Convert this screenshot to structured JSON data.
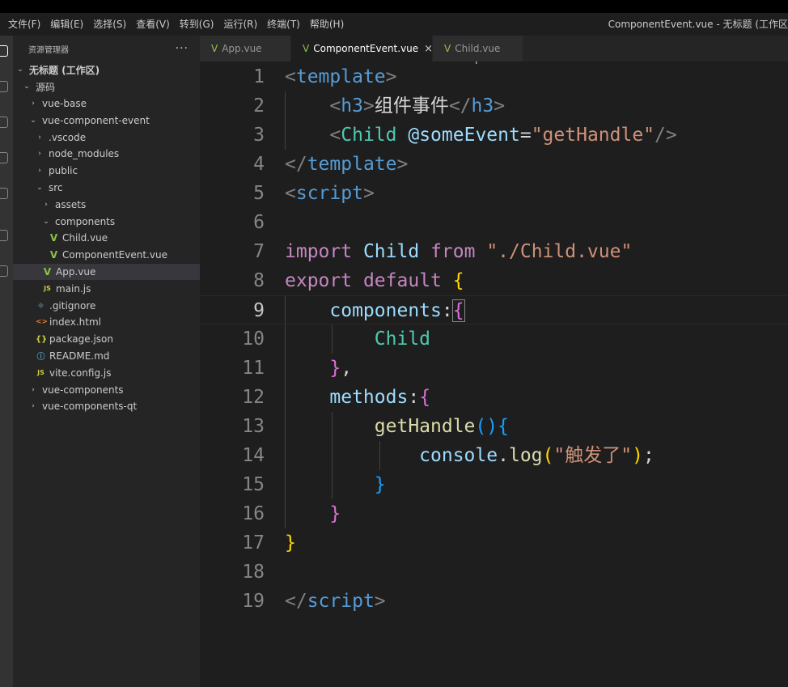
{
  "menu": [
    "文件(F)",
    "编辑(E)",
    "选择(S)",
    "查看(V)",
    "转到(G)",
    "运行(R)",
    "终端(T)",
    "帮助(H)"
  ],
  "window_title": "ComponentEvent.vue - 无标题 (工作区",
  "sidebar": {
    "title": "资源管理器",
    "more": "···",
    "items": [
      {
        "label": "无标题 (工作区)",
        "indent": 0,
        "chev": "v",
        "icon": ""
      },
      {
        "label": "源码",
        "indent": 1,
        "chev": "v",
        "icon": ""
      },
      {
        "label": "vue-base",
        "indent": 2,
        "chev": ">",
        "icon": ""
      },
      {
        "label": "vue-component-event",
        "indent": 2,
        "chev": "v",
        "icon": ""
      },
      {
        "label": ".vscode",
        "indent": 3,
        "chev": ">",
        "icon": ""
      },
      {
        "label": "node_modules",
        "indent": 3,
        "chev": ">",
        "icon": ""
      },
      {
        "label": "public",
        "indent": 3,
        "chev": ">",
        "icon": ""
      },
      {
        "label": "src",
        "indent": 3,
        "chev": "v",
        "icon": ""
      },
      {
        "label": "assets",
        "indent": 4,
        "chev": ">",
        "icon": ""
      },
      {
        "label": "components",
        "indent": 4,
        "chev": "v",
        "icon": ""
      },
      {
        "label": "Child.vue",
        "indent": 5,
        "chev": "",
        "icon": "vue"
      },
      {
        "label": "ComponentEvent.vue",
        "indent": 5,
        "chev": "",
        "icon": "vue"
      },
      {
        "label": "App.vue",
        "indent": 4,
        "chev": "",
        "icon": "vue"
      },
      {
        "label": "main.js",
        "indent": 4,
        "chev": "",
        "icon": "js"
      },
      {
        "label": ".gitignore",
        "indent": 3,
        "chev": "",
        "icon": "git"
      },
      {
        "label": "index.html",
        "indent": 3,
        "chev": "",
        "icon": "html"
      },
      {
        "label": "package.json",
        "indent": 3,
        "chev": "",
        "icon": "json"
      },
      {
        "label": "README.md",
        "indent": 3,
        "chev": "",
        "icon": "info"
      },
      {
        "label": "vite.config.js",
        "indent": 3,
        "chev": "",
        "icon": "js"
      },
      {
        "label": "vue-components",
        "indent": 2,
        "chev": ">",
        "icon": ""
      },
      {
        "label": "vue-components-qt",
        "indent": 2,
        "chev": ">",
        "icon": ""
      }
    ]
  },
  "tabs": [
    {
      "label": "App.vue",
      "active": false
    },
    {
      "label": "ComponentEvent.vue",
      "active": true,
      "close": "×"
    },
    {
      "label": "Child.vue",
      "active": false
    }
  ],
  "cursor_glyph": "I",
  "editor": {
    "current_line": 9,
    "lines": [
      [
        [
          "<",
          "br"
        ],
        [
          "template",
          "tg"
        ],
        [
          ">",
          "br"
        ]
      ],
      [
        [
          "    ",
          "wh"
        ],
        [
          "<",
          "br"
        ],
        [
          "h3",
          "tg"
        ],
        [
          ">",
          "br"
        ],
        [
          "组件事件",
          "txt"
        ],
        [
          "</",
          "br"
        ],
        [
          "h3",
          "tg"
        ],
        [
          ">",
          "br"
        ]
      ],
      [
        [
          "    ",
          "wh"
        ],
        [
          "<",
          "br"
        ],
        [
          "Child",
          "cls"
        ],
        [
          " ",
          "wh"
        ],
        [
          "@someEvent",
          "var"
        ],
        [
          "=",
          "wh"
        ],
        [
          "\"getHandle\"",
          "str"
        ],
        [
          "/>",
          "br"
        ]
      ],
      [
        [
          "</",
          "br"
        ],
        [
          "template",
          "tg"
        ],
        [
          ">",
          "br"
        ]
      ],
      [
        [
          "<",
          "br"
        ],
        [
          "script",
          "tg"
        ],
        [
          ">",
          "br"
        ]
      ],
      [],
      [
        [
          "import",
          "kw"
        ],
        [
          " ",
          "wh"
        ],
        [
          "Child",
          "var"
        ],
        [
          " ",
          "wh"
        ],
        [
          "from",
          "kw"
        ],
        [
          " ",
          "wh"
        ],
        [
          "\"./Child.vue\"",
          "str"
        ]
      ],
      [
        [
          "export",
          "kw"
        ],
        [
          " ",
          "wh"
        ],
        [
          "default",
          "kw"
        ],
        [
          " ",
          "wh"
        ],
        [
          "{",
          "y"
        ]
      ],
      [
        [
          "    ",
          "wh"
        ],
        [
          "components",
          "var"
        ],
        [
          ":",
          "wh"
        ],
        [
          "{",
          "p"
        ]
      ],
      [
        [
          "        ",
          "wh"
        ],
        [
          "Child",
          "cls"
        ]
      ],
      [
        [
          "    ",
          "wh"
        ],
        [
          "}",
          "p"
        ],
        [
          ",",
          "wh"
        ]
      ],
      [
        [
          "    ",
          "wh"
        ],
        [
          "methods",
          "var"
        ],
        [
          ":",
          "wh"
        ],
        [
          "{",
          "p"
        ]
      ],
      [
        [
          "        ",
          "wh"
        ],
        [
          "getHandle",
          "fn"
        ],
        [
          "()",
          "b2"
        ],
        [
          "{",
          "b2"
        ]
      ],
      [
        [
          "            ",
          "wh"
        ],
        [
          "console",
          "var"
        ],
        [
          ".",
          "wh"
        ],
        [
          "log",
          "fn"
        ],
        [
          "(",
          "y"
        ],
        [
          "\"触发了\"",
          "str"
        ],
        [
          ")",
          "y"
        ],
        [
          ";",
          "wh"
        ]
      ],
      [
        [
          "        ",
          "wh"
        ],
        [
          "}",
          "b2"
        ]
      ],
      [
        [
          "    ",
          "wh"
        ],
        [
          "}",
          "p"
        ]
      ],
      [
        [
          "}",
          "y"
        ]
      ],
      [],
      [
        [
          "</",
          "br"
        ],
        [
          "script",
          "tg"
        ],
        [
          ">",
          "br"
        ]
      ]
    ]
  }
}
